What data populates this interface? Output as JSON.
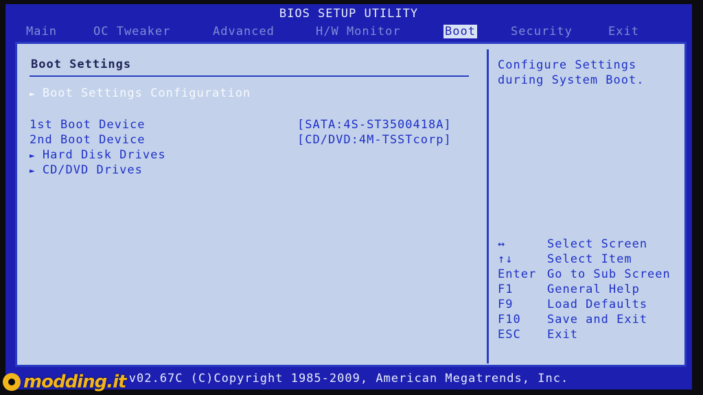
{
  "header": {
    "title": "BIOS SETUP UTILITY"
  },
  "menu": {
    "tabs": [
      {
        "label": "Main"
      },
      {
        "label": "OC Tweaker"
      },
      {
        "label": "Advanced"
      },
      {
        "label": "H/W Monitor"
      },
      {
        "label": "Boot"
      },
      {
        "label": "Security"
      },
      {
        "label": "Exit"
      }
    ],
    "active": "Boot"
  },
  "left": {
    "heading": "Boot Settings",
    "items": [
      {
        "label": "Boot Settings Configuration",
        "submenu": true
      },
      {
        "label": "1st Boot Device",
        "value": "[SATA:4S-ST3500418A]"
      },
      {
        "label": "2nd Boot Device",
        "value": "[CD/DVD:4M-TSSTcorp]"
      },
      {
        "label": "Hard Disk Drives",
        "submenu": true
      },
      {
        "label": "CD/DVD Drives",
        "submenu": true
      }
    ]
  },
  "help": {
    "line1": "Configure Settings",
    "line2": "during System Boot."
  },
  "keys": [
    {
      "key": "↔",
      "action": "Select Screen"
    },
    {
      "key": "↑↓",
      "action": "Select Item"
    },
    {
      "key": "Enter",
      "action": "Go to Sub Screen"
    },
    {
      "key": "F1",
      "action": "General Help"
    },
    {
      "key": "F9",
      "action": "Load Defaults"
    },
    {
      "key": "F10",
      "action": "Save and Exit"
    },
    {
      "key": "ESC",
      "action": "Exit"
    }
  ],
  "footer": {
    "text": "v02.67C (C)Copyright 1985-2009, American Megatrends, Inc."
  },
  "watermark": {
    "text": "modding.it"
  },
  "colors": {
    "frame": "#1d1fb0",
    "panel": "#c3d2ea",
    "text_blue": "#1e2fc8"
  }
}
